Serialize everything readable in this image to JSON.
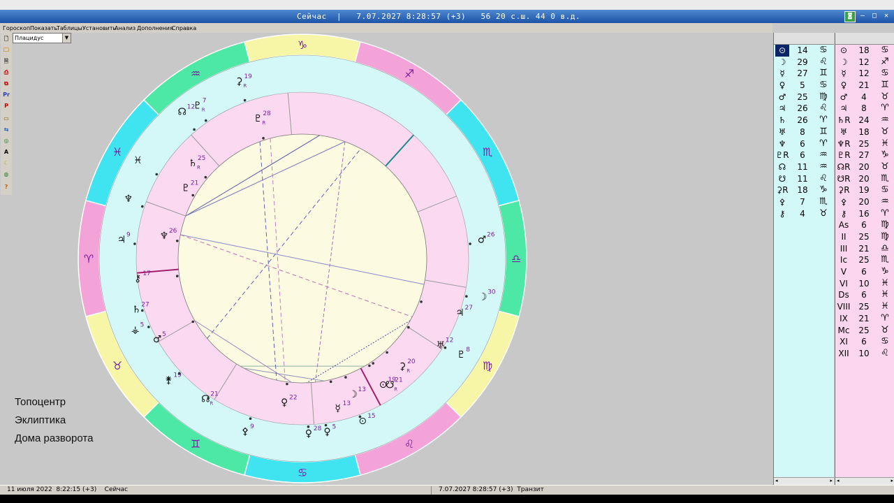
{
  "window": {
    "title": "Сейчас  |   7.07.2027 8:28:57 (+3)   56 20 с.ш. 44 0 в.д."
  },
  "menu": {
    "items": [
      "Гороскоп",
      "Показать",
      "Таблицы",
      "Установить",
      "Анализ",
      "Дополнения",
      "Справка"
    ]
  },
  "house_system": {
    "value": "Плацидус"
  },
  "toolbar": {
    "buttons": [
      "",
      "",
      "",
      "",
      "Pr",
      "P",
      "",
      "",
      "",
      "A",
      "",
      "",
      "?"
    ]
  },
  "labels": {
    "line1": "Топоцентр",
    "line2": "Эклиптика",
    "line3": "Дома разворота"
  },
  "colors": {
    "fire": "#f4a3d9",
    "earth": "#f6f6a6",
    "air": "#4ee8a6",
    "water": "#3fe4f0",
    "outer_ring": "#d4f7f7",
    "inner_ring": "#fbd9f1",
    "center": "#fcfae0",
    "glyph": "#7b1fa2"
  },
  "zodiac_ring": [
    {
      "glyph": "♑",
      "element": "earth"
    },
    {
      "glyph": "♐",
      "element": "fire"
    },
    {
      "glyph": "♏",
      "element": "water"
    },
    {
      "glyph": "♎",
      "element": "air"
    },
    {
      "glyph": "♍",
      "element": "earth"
    },
    {
      "glyph": "♌",
      "element": "fire"
    },
    {
      "glyph": "♋",
      "element": "water"
    },
    {
      "glyph": "♊",
      "element": "air"
    },
    {
      "glyph": "♉",
      "element": "earth"
    },
    {
      "glyph": "♈",
      "element": "fire"
    },
    {
      "glyph": "♓",
      "element": "water"
    },
    {
      "glyph": "♒",
      "element": "air"
    }
  ],
  "outer_planets": [
    {
      "glyph": "⚳",
      "deg": "19",
      "mark": "R"
    },
    {
      "glyph": "♇",
      "deg": "7",
      "mark": "R"
    },
    {
      "glyph": "☊",
      "deg": "12",
      "mark": ""
    },
    {
      "glyph": "♓",
      "deg": "",
      "mark": ""
    },
    {
      "glyph": "♆",
      "deg": "",
      "mark": ""
    },
    {
      "glyph": "♃",
      "deg": "9",
      "mark": ""
    },
    {
      "glyph": "⚷",
      "deg": "17",
      "mark": ""
    },
    {
      "glyph": "♄",
      "deg": "27",
      "mark": ""
    },
    {
      "glyph": "⚶",
      "deg": "5",
      "mark": ""
    },
    {
      "glyph": "♂",
      "deg": "5",
      "mark": ""
    },
    {
      "glyph": "⚵",
      "deg": "19",
      "mark": ""
    },
    {
      "glyph": "☊",
      "deg": "21",
      "mark": "R"
    },
    {
      "glyph": "⚴",
      "deg": "9",
      "mark": ""
    },
    {
      "glyph": "♀",
      "deg": "22",
      "mark": ""
    },
    {
      "glyph": "♀",
      "deg": "28",
      "mark": ""
    },
    {
      "glyph": "♀",
      "deg": "5",
      "mark": ""
    },
    {
      "glyph": "☿",
      "deg": "13",
      "mark": ""
    },
    {
      "glyph": "⊙",
      "deg": "15",
      "mark": ""
    },
    {
      "glyph": "⊙",
      "deg": "19",
      "mark": ""
    },
    {
      "glyph": "⚳",
      "deg": "20",
      "mark": "R"
    },
    {
      "glyph": "♅",
      "deg": "12",
      "mark": ""
    },
    {
      "glyph": "♃",
      "deg": "27",
      "mark": ""
    },
    {
      "glyph": "☽",
      "deg": "30",
      "mark": ""
    },
    {
      "glyph": "♂",
      "deg": "26",
      "mark": ""
    },
    {
      "glyph": "♇",
      "deg": "8",
      "mark": ""
    },
    {
      "glyph": "☋",
      "deg": "21",
      "mark": "R"
    },
    {
      "glyph": "☽",
      "deg": "13",
      "mark": ""
    }
  ],
  "inner_planets": [
    {
      "glyph": "♇",
      "deg": "28",
      "mark": "R"
    },
    {
      "glyph": "♄",
      "deg": "25",
      "mark": "R"
    },
    {
      "glyph": "♇",
      "deg": "21",
      "mark": ""
    },
    {
      "glyph": "♆",
      "deg": "26",
      "mark": ""
    }
  ],
  "table1": [
    {
      "g": "⊙",
      "n": "14",
      "s": "♋",
      "sel": true
    },
    {
      "g": "☽",
      "n": "29",
      "s": "♌"
    },
    {
      "g": "☿",
      "n": "27",
      "s": "♊"
    },
    {
      "g": "♀",
      "n": "5",
      "s": "♋"
    },
    {
      "g": "♂",
      "n": "25",
      "s": "♍"
    },
    {
      "g": "♃",
      "n": "26",
      "s": "♌"
    },
    {
      "g": "♄",
      "n": "26",
      "s": "♈"
    },
    {
      "g": "♅",
      "n": "8",
      "s": "♊"
    },
    {
      "g": "♆",
      "n": "6",
      "s": "♈"
    },
    {
      "g": "♇R",
      "n": "6",
      "s": "♒"
    },
    {
      "g": "☊",
      "n": "11",
      "s": "♒"
    },
    {
      "g": "☋",
      "n": "11",
      "s": "♌"
    },
    {
      "g": "⚳R",
      "n": "18",
      "s": "♑"
    },
    {
      "g": "⚴",
      "n": "7",
      "s": "♏"
    },
    {
      "g": "⚷",
      "n": "4",
      "s": "♉"
    }
  ],
  "table2": [
    {
      "g": "⊙",
      "n": "18",
      "s": "♋"
    },
    {
      "g": "☽",
      "n": "12",
      "s": "♐"
    },
    {
      "g": "☿",
      "n": "12",
      "s": "♋"
    },
    {
      "g": "♀",
      "n": "21",
      "s": "♊"
    },
    {
      "g": "♂",
      "n": "4",
      "s": "♉"
    },
    {
      "g": "♃",
      "n": "8",
      "s": "♈"
    },
    {
      "g": "♄R",
      "n": "24",
      "s": "♒"
    },
    {
      "g": "♅",
      "n": "18",
      "s": "♉"
    },
    {
      "g": "♆R",
      "n": "25",
      "s": "♓"
    },
    {
      "g": "♇R",
      "n": "27",
      "s": "♑"
    },
    {
      "g": "☊R",
      "n": "20",
      "s": "♉"
    },
    {
      "g": "☋R",
      "n": "20",
      "s": "♏"
    },
    {
      "g": "⚳R",
      "n": "19",
      "s": "♋"
    },
    {
      "g": "⚴",
      "n": "20",
      "s": "♒"
    },
    {
      "g": "⚷",
      "n": "16",
      "s": "♈"
    },
    {
      "g": "As",
      "n": "6",
      "s": "♍"
    },
    {
      "g": "II",
      "n": "25",
      "s": "♍"
    },
    {
      "g": "III",
      "n": "21",
      "s": "♎"
    },
    {
      "g": "Ic",
      "n": "25",
      "s": "♏"
    },
    {
      "g": "V",
      "n": "6",
      "s": "♑"
    },
    {
      "g": "VI",
      "n": "10",
      "s": "♓"
    },
    {
      "g": "Ds",
      "n": "6",
      "s": "♓"
    },
    {
      "g": "VIII",
      "n": "25",
      "s": "♓"
    },
    {
      "g": "IX",
      "n": "21",
      "s": "♈"
    },
    {
      "g": "Mc",
      "n": "25",
      "s": "♉"
    },
    {
      "g": "XI",
      "n": "6",
      "s": "♋"
    },
    {
      "g": "XII",
      "n": "10",
      "s": "♌"
    }
  ],
  "status": {
    "left": "11 июля 2022  8:22:15 (+3)    Сейчас",
    "right": "7.07.2027 8:28:57 (+3)  Транзит"
  }
}
